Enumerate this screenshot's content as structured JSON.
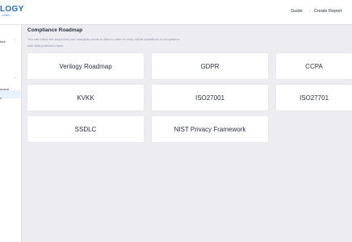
{
  "brand": {
    "name": "LOGY",
    "tagline": "...rofiled"
  },
  "topbar": {
    "guide_label": "Guide",
    "separator": "/",
    "create_report_label": "Create Report"
  },
  "sidebar": {
    "items": [
      {
        "label": "ture"
      },
      {
        "label": "ement"
      },
      {
        "label": "n"
      }
    ]
  },
  "page": {
    "title": "Compliance Roadmap",
    "description_line1": "You can follow the steps that your company needs to take in order to carry out its operations in compliance",
    "description_line2": "with data protection laws."
  },
  "roadmaps": [
    {
      "label": "Verilogy Roadmap"
    },
    {
      "label": "GDPR"
    },
    {
      "label": "CCPA"
    },
    {
      "label": "KVKK"
    },
    {
      "label": "ISO27001"
    },
    {
      "label": "ISO27701"
    },
    {
      "label": "SSDLC"
    },
    {
      "label": "NIST Privacy Framework"
    }
  ]
}
